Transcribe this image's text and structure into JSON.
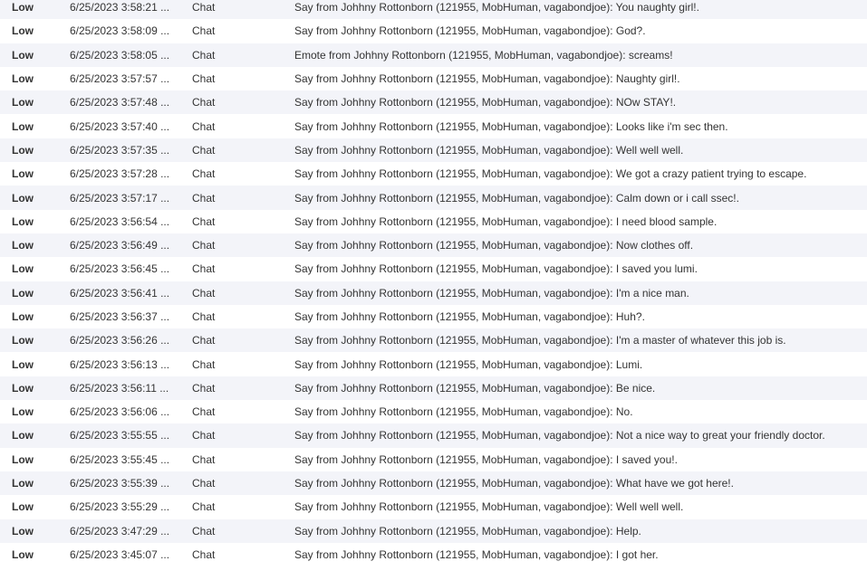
{
  "rows": [
    {
      "severity": "Low",
      "time": "6/25/2023 3:58:21 ...",
      "type": "Chat",
      "message": "Say from Johhny Rottonborn (121955, MobHuman, vagabondjoe): You naughty girl!."
    },
    {
      "severity": "Low",
      "time": "6/25/2023 3:58:09 ...",
      "type": "Chat",
      "message": "Say from Johhny Rottonborn (121955, MobHuman, vagabondjoe): God?."
    },
    {
      "severity": "Low",
      "time": "6/25/2023 3:58:05 ...",
      "type": "Chat",
      "message": "Emote from Johhny Rottonborn (121955, MobHuman, vagabondjoe): screams!"
    },
    {
      "severity": "Low",
      "time": "6/25/2023 3:57:57 ...",
      "type": "Chat",
      "message": "Say from Johhny Rottonborn (121955, MobHuman, vagabondjoe): Naughty girl!."
    },
    {
      "severity": "Low",
      "time": "6/25/2023 3:57:48 ...",
      "type": "Chat",
      "message": "Say from Johhny Rottonborn (121955, MobHuman, vagabondjoe): NOw STAY!."
    },
    {
      "severity": "Low",
      "time": "6/25/2023 3:57:40 ...",
      "type": "Chat",
      "message": "Say from Johhny Rottonborn (121955, MobHuman, vagabondjoe): Looks like i'm sec then."
    },
    {
      "severity": "Low",
      "time": "6/25/2023 3:57:35 ...",
      "type": "Chat",
      "message": "Say from Johhny Rottonborn (121955, MobHuman, vagabondjoe): Well well well."
    },
    {
      "severity": "Low",
      "time": "6/25/2023 3:57:28 ...",
      "type": "Chat",
      "message": "Say from Johhny Rottonborn (121955, MobHuman, vagabondjoe): We got a crazy patient trying to escape."
    },
    {
      "severity": "Low",
      "time": "6/25/2023 3:57:17 ...",
      "type": "Chat",
      "message": "Say from Johhny Rottonborn (121955, MobHuman, vagabondjoe): Calm down or i call ssec!."
    },
    {
      "severity": "Low",
      "time": "6/25/2023 3:56:54 ...",
      "type": "Chat",
      "message": "Say from Johhny Rottonborn (121955, MobHuman, vagabondjoe): I need blood sample."
    },
    {
      "severity": "Low",
      "time": "6/25/2023 3:56:49 ...",
      "type": "Chat",
      "message": "Say from Johhny Rottonborn (121955, MobHuman, vagabondjoe): Now clothes off."
    },
    {
      "severity": "Low",
      "time": "6/25/2023 3:56:45 ...",
      "type": "Chat",
      "message": "Say from Johhny Rottonborn (121955, MobHuman, vagabondjoe): I saved you lumi."
    },
    {
      "severity": "Low",
      "time": "6/25/2023 3:56:41 ...",
      "type": "Chat",
      "message": "Say from Johhny Rottonborn (121955, MobHuman, vagabondjoe): I'm a nice man."
    },
    {
      "severity": "Low",
      "time": "6/25/2023 3:56:37 ...",
      "type": "Chat",
      "message": "Say from Johhny Rottonborn (121955, MobHuman, vagabondjoe): Huh?."
    },
    {
      "severity": "Low",
      "time": "6/25/2023 3:56:26 ...",
      "type": "Chat",
      "message": "Say from Johhny Rottonborn (121955, MobHuman, vagabondjoe): I'm a master of whatever this job is."
    },
    {
      "severity": "Low",
      "time": "6/25/2023 3:56:13 ...",
      "type": "Chat",
      "message": "Say from Johhny Rottonborn (121955, MobHuman, vagabondjoe): Lumi."
    },
    {
      "severity": "Low",
      "time": "6/25/2023 3:56:11 ...",
      "type": "Chat",
      "message": "Say from Johhny Rottonborn (121955, MobHuman, vagabondjoe): Be nice."
    },
    {
      "severity": "Low",
      "time": "6/25/2023 3:56:06 ...",
      "type": "Chat",
      "message": "Say from Johhny Rottonborn (121955, MobHuman, vagabondjoe): No."
    },
    {
      "severity": "Low",
      "time": "6/25/2023 3:55:55 ...",
      "type": "Chat",
      "message": "Say from Johhny Rottonborn (121955, MobHuman, vagabondjoe): Not a nice way to great your friendly doctor."
    },
    {
      "severity": "Low",
      "time": "6/25/2023 3:55:45 ...",
      "type": "Chat",
      "message": "Say from Johhny Rottonborn (121955, MobHuman, vagabondjoe): I saved you!."
    },
    {
      "severity": "Low",
      "time": "6/25/2023 3:55:39 ...",
      "type": "Chat",
      "message": "Say from Johhny Rottonborn (121955, MobHuman, vagabondjoe): What have we got here!."
    },
    {
      "severity": "Low",
      "time": "6/25/2023 3:55:29 ...",
      "type": "Chat",
      "message": "Say from Johhny Rottonborn (121955, MobHuman, vagabondjoe): Well well well."
    },
    {
      "severity": "Low",
      "time": "6/25/2023 3:47:29 ...",
      "type": "Chat",
      "message": "Say from Johhny Rottonborn (121955, MobHuman, vagabondjoe): Help."
    },
    {
      "severity": "Low",
      "time": "6/25/2023 3:45:07 ...",
      "type": "Chat",
      "message": "Say from Johhny Rottonborn (121955, MobHuman, vagabondjoe): I got her."
    }
  ]
}
